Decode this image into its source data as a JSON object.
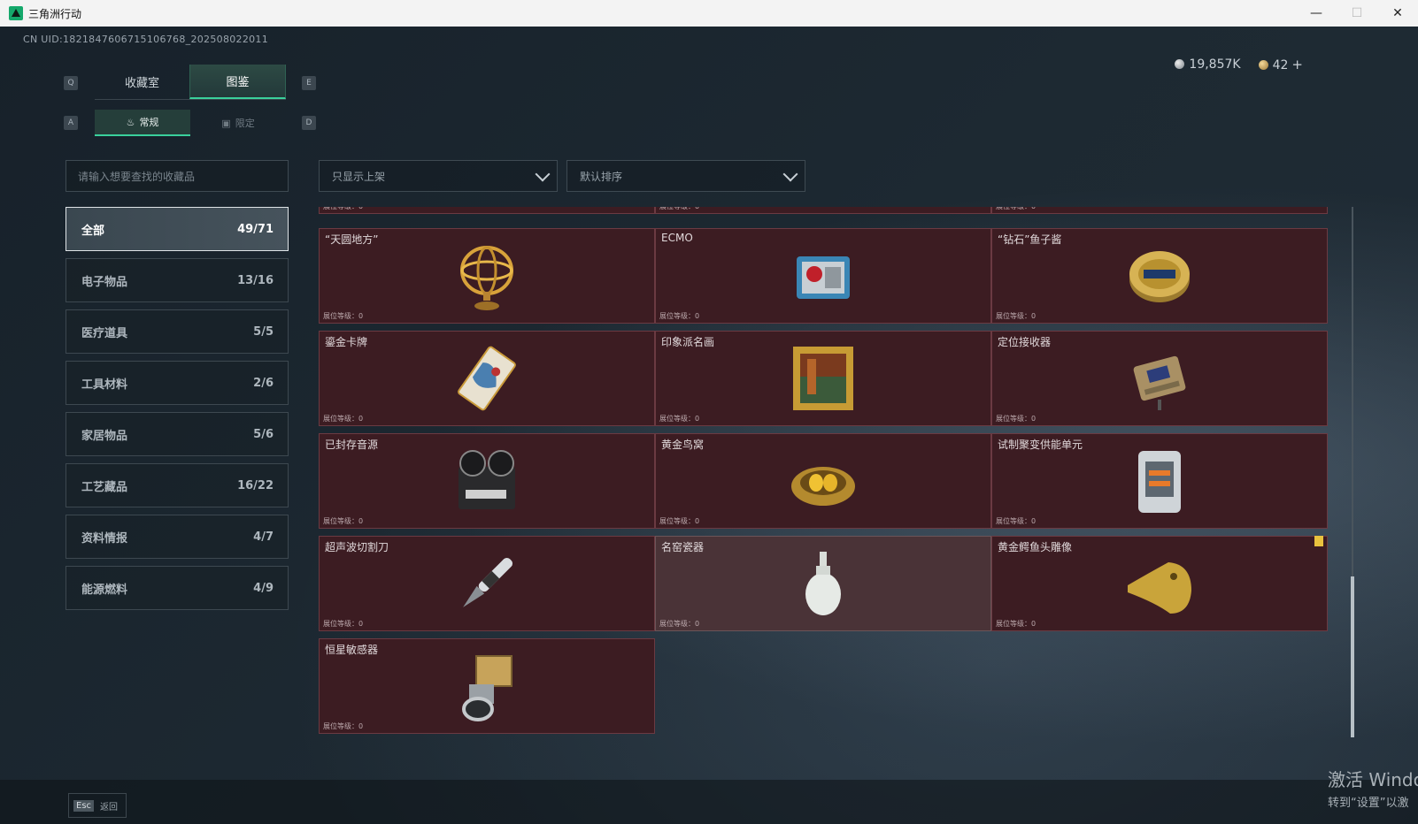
{
  "window": {
    "title": "三角洲行动",
    "minimize": "—",
    "maximize": "☐",
    "close": "✕"
  },
  "uid": "CN UID:1821847606715106768_202508022011",
  "currency": {
    "silver": "19,857K",
    "gold": "42",
    "plus": "+"
  },
  "keys": {
    "tab_prev": "Q",
    "tab_next": "E",
    "sub_prev": "A",
    "sub_next": "D"
  },
  "tabs": [
    {
      "label": "收藏室",
      "active": false
    },
    {
      "label": "图鉴",
      "active": true
    }
  ],
  "subtabs": [
    {
      "label": "常规",
      "icon": "flame-icon",
      "active": true
    },
    {
      "label": "限定",
      "icon": "picture-icon",
      "active": false
    }
  ],
  "search": {
    "placeholder": "请输入想要查找的收藏品"
  },
  "filters": {
    "show": "只显示上架",
    "sort": "默认排序"
  },
  "categories": [
    {
      "label": "全部",
      "count": "49/71",
      "active": true
    },
    {
      "label": "电子物品",
      "count": "13/16"
    },
    {
      "label": "医疗道具",
      "count": "5/5"
    },
    {
      "label": "工具材料",
      "count": "2/6"
    },
    {
      "label": "家居物品",
      "count": "5/6"
    },
    {
      "label": "工艺藏品",
      "count": "16/22"
    },
    {
      "label": "资料情报",
      "count": "4/7"
    },
    {
      "label": "能源燃料",
      "count": "4/9"
    }
  ],
  "level_label": "展位等级：0",
  "items": [
    {
      "name": "",
      "icon": "partial-item"
    },
    {
      "name": "",
      "icon": "partial-item"
    },
    {
      "name": "",
      "icon": "partial-item"
    },
    {
      "name": "“天圆地方”",
      "icon": "armillary-sphere-icon"
    },
    {
      "name": "ECMO",
      "icon": "ecmo-machine-icon"
    },
    {
      "name": "“钻石”鱼子酱",
      "icon": "caviar-tin-icon"
    },
    {
      "name": "鎏金卡牌",
      "icon": "gilded-card-icon"
    },
    {
      "name": "印象派名画",
      "icon": "framed-painting-icon"
    },
    {
      "name": "定位接收器",
      "icon": "locator-receiver-icon"
    },
    {
      "name": "已封存音源",
      "icon": "tape-recorder-icon"
    },
    {
      "name": "黄金鸟窝",
      "icon": "golden-nest-icon"
    },
    {
      "name": "试制聚变供能单元",
      "icon": "fusion-unit-icon"
    },
    {
      "name": "超声波切割刀",
      "icon": "ultrasonic-cutter-icon"
    },
    {
      "name": "名窑瓷器",
      "icon": "porcelain-vase-icon",
      "highlight": true
    },
    {
      "name": "黄金鳄鱼头雕像",
      "icon": "gold-crocodile-head-icon",
      "warning": true
    },
    {
      "name": "恒星敏感器",
      "icon": "star-sensor-icon"
    }
  ],
  "bottom": {
    "esc_key": "Esc",
    "back": "返回"
  },
  "watermark": {
    "line1": "激活 Windo",
    "line2": "转到“设置”以激"
  }
}
